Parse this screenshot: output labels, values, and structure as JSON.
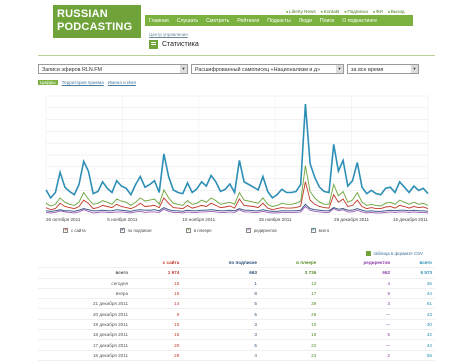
{
  "logo": {
    "line1": "RUSSIAN",
    "line2": "PODCASTING"
  },
  "nav": [
    "Главная",
    "Слушать",
    "Смотреть",
    "Рейтинги",
    "Подкасты",
    "Люди",
    "Поиск",
    "О подкастинге"
  ],
  "toplinks": [
    "Liberty News",
    "Kontakt",
    "Подписка",
    "ФИ",
    "Выход"
  ],
  "breadcrumb": "Центр управления",
  "page_title": "Статистика",
  "selects": {
    "feed": "Записи эфиров RLN.FM",
    "episode": "Расшифрованный самописец «Национализм и д»",
    "period": "за все время"
  },
  "tabs": [
    "Цифры",
    "Территория приема",
    "Имена и Имя"
  ],
  "legend": [
    "с сайта",
    "по подписке",
    "в плеере",
    "редиректов",
    "всего"
  ],
  "csv_link": "таблица в формате CSV",
  "colors": {
    "site": "#c0392b",
    "subscr": "#2c4e7a",
    "player": "#6aa33a",
    "redirect": "#9e5ab8",
    "total": "#2d8fb5"
  },
  "chart_data": {
    "type": "line",
    "x_ticks": [
      "26 октября 2011",
      "5 ноября 2011",
      "15 ноября 2011",
      "25 ноября 2011",
      "28 декабря 2011",
      "15 декабря 2011"
    ],
    "grid": true,
    "series": [
      {
        "name": "всего",
        "values": [
          45,
          30,
          40,
          78,
          50,
          42,
          36,
          55,
          98,
          80,
          38,
          42,
          60,
          48,
          40,
          62,
          52,
          48,
          36,
          55,
          70,
          50,
          55,
          62,
          40,
          112,
          70,
          45,
          40,
          38,
          58,
          40,
          47,
          60,
          52,
          72,
          60,
          42,
          46,
          56,
          40,
          100,
          60,
          55,
          50,
          45,
          70,
          42,
          30,
          36,
          46,
          40,
          40,
          42,
          55,
          205,
          94,
          68,
          50,
          42,
          40,
          130,
          80,
          100,
          52,
          62,
          96,
          50,
          38,
          44,
          38,
          36,
          48,
          50,
          40,
          60,
          50,
          40,
          52,
          44,
          48,
          38
        ]
      },
      {
        "name": "в плеере",
        "values": [
          20,
          15,
          18,
          30,
          22,
          18,
          16,
          22,
          40,
          28,
          18,
          20,
          25,
          22,
          18,
          28,
          24,
          22,
          16,
          22,
          30,
          24,
          26,
          28,
          18,
          45,
          30,
          20,
          18,
          16,
          25,
          18,
          20,
          26,
          22,
          30,
          25,
          18,
          20,
          22,
          18,
          40,
          26,
          24,
          22,
          20,
          30,
          18,
          14,
          16,
          20,
          18,
          18,
          20,
          24,
          90,
          42,
          30,
          22,
          18,
          18,
          55,
          34,
          42,
          22,
          26,
          40,
          22,
          16,
          18,
          16,
          15,
          20,
          22,
          18,
          26,
          22,
          18,
          22,
          18,
          20,
          16
        ]
      },
      {
        "name": "с сайта",
        "values": [
          12,
          8,
          10,
          20,
          14,
          12,
          10,
          14,
          26,
          20,
          10,
          12,
          16,
          14,
          12,
          18,
          14,
          12,
          10,
          14,
          20,
          14,
          15,
          16,
          12,
          30,
          20,
          12,
          11,
          10,
          16,
          11,
          13,
          16,
          14,
          20,
          16,
          12,
          13,
          15,
          11,
          28,
          16,
          15,
          14,
          12,
          20,
          11,
          8,
          10,
          12,
          11,
          11,
          12,
          15,
          60,
          26,
          18,
          14,
          12,
          11,
          36,
          22,
          28,
          14,
          16,
          26,
          14,
          10,
          12,
          10,
          10,
          13,
          14,
          11,
          16,
          14,
          11,
          14,
          12,
          13,
          10
        ]
      },
      {
        "name": "по подписке",
        "values": [
          6,
          5,
          6,
          8,
          6,
          6,
          5,
          7,
          10,
          8,
          6,
          6,
          7,
          6,
          6,
          8,
          7,
          6,
          5,
          7,
          8,
          7,
          7,
          8,
          6,
          12,
          8,
          6,
          6,
          5,
          7,
          6,
          6,
          7,
          7,
          8,
          7,
          6,
          6,
          7,
          6,
          10,
          7,
          7,
          6,
          6,
          8,
          6,
          5,
          5,
          6,
          6,
          6,
          6,
          7,
          18,
          10,
          8,
          7,
          6,
          6,
          12,
          9,
          10,
          7,
          7,
          10,
          7,
          5,
          6,
          5,
          5,
          6,
          7,
          6,
          7,
          7,
          6,
          7,
          6,
          6,
          5
        ]
      },
      {
        "name": "редиректов",
        "values": [
          3,
          2,
          3,
          6,
          4,
          3,
          2,
          4,
          8,
          5,
          2,
          3,
          4,
          3,
          3,
          4,
          4,
          3,
          2,
          4,
          5,
          3,
          4,
          4,
          3,
          9,
          5,
          3,
          3,
          2,
          4,
          3,
          3,
          4,
          4,
          5,
          4,
          3,
          3,
          4,
          3,
          8,
          4,
          4,
          3,
          3,
          5,
          3,
          2,
          2,
          3,
          3,
          3,
          3,
          4,
          14,
          7,
          5,
          4,
          3,
          3,
          10,
          6,
          8,
          4,
          4,
          7,
          4,
          2,
          3,
          2,
          2,
          3,
          4,
          3,
          4,
          4,
          3,
          4,
          3,
          3,
          2
        ]
      }
    ]
  },
  "table": {
    "headers": [
      "",
      "с сайта",
      "по подписке",
      "в плеере",
      "редиректов",
      "всего"
    ],
    "rows": [
      {
        "label": "всего",
        "site": "1 974",
        "subscr": "663",
        "player": "3 736",
        "redirect": "662",
        "total": "6 573"
      },
      {
        "label": "сегодня",
        "site": "15",
        "subscr": "1",
        "player": "13",
        "redirect": "4",
        "total": "36"
      },
      {
        "label": "вчера",
        "site": "15",
        "subscr": "8",
        "player": "17",
        "redirect": "9",
        "total": "44"
      },
      {
        "label": "21 декабря 2011",
        "site": "14",
        "subscr": "5",
        "player": "39",
        "redirect": "3",
        "total": "61"
      },
      {
        "label": "20 декабря 2011",
        "site": "9",
        "subscr": "5",
        "player": "29",
        "redirect": "—",
        "total": "43"
      },
      {
        "label": "19 декабря 2011",
        "site": "10",
        "subscr": "3",
        "player": "10",
        "redirect": "—",
        "total": "30"
      },
      {
        "label": "18 декабря 2011",
        "site": "15",
        "subscr": "3",
        "player": "19",
        "redirect": "5",
        "total": "42"
      },
      {
        "label": "17 декабря 2011",
        "site": "20",
        "subscr": "5",
        "player": "22",
        "redirect": "—",
        "total": "44"
      },
      {
        "label": "16 декабря 2011",
        "site": "29",
        "subscr": "4",
        "player": "23",
        "redirect": "2",
        "total": "58"
      }
    ]
  }
}
